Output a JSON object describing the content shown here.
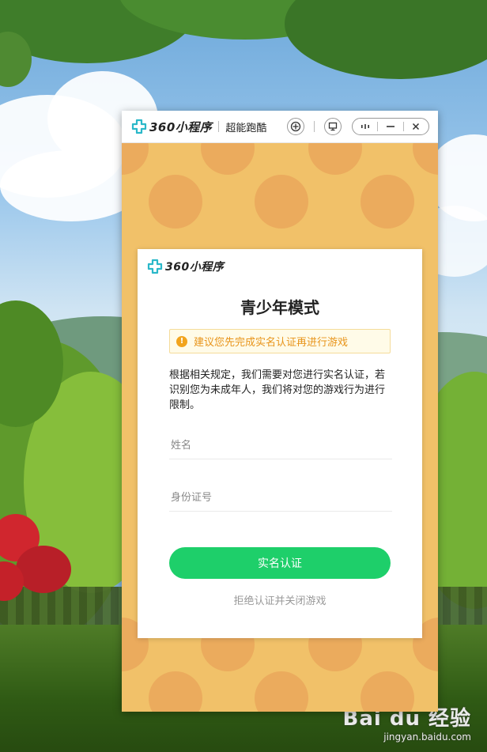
{
  "window": {
    "brand": "360小程序",
    "game_title": "超能跑酷"
  },
  "dialog": {
    "brand": "360小程序",
    "title": "青少年模式",
    "notice": "建议您先完成实名认证再进行游戏",
    "description": "根据相关规定，我们需要对您进行实名认证，若识别您为未成年人，我们将对您的游戏行为进行限制。",
    "name_placeholder": "姓名",
    "id_placeholder": "身份证号",
    "verify_button": "实名认证",
    "refuse_link": "拒绝认证并关闭游戏"
  },
  "watermark": {
    "logo": "Bai du 经验",
    "url": "jingyan.baidu.com"
  },
  "colors": {
    "brand_accent": "#2bb8c9",
    "verify_button": "#1ecf6a",
    "notice_text": "#e8941a",
    "game_bg": "#f1c169",
    "game_dots": "#ebab5d"
  },
  "icons": {
    "brand": "cross-logo-icon",
    "game_center": "gamepad-icon",
    "screen": "monitor-icon",
    "more": "more-dots-icon",
    "minimize": "minimize-icon",
    "close": "close-icon",
    "warning": "warning-icon"
  }
}
